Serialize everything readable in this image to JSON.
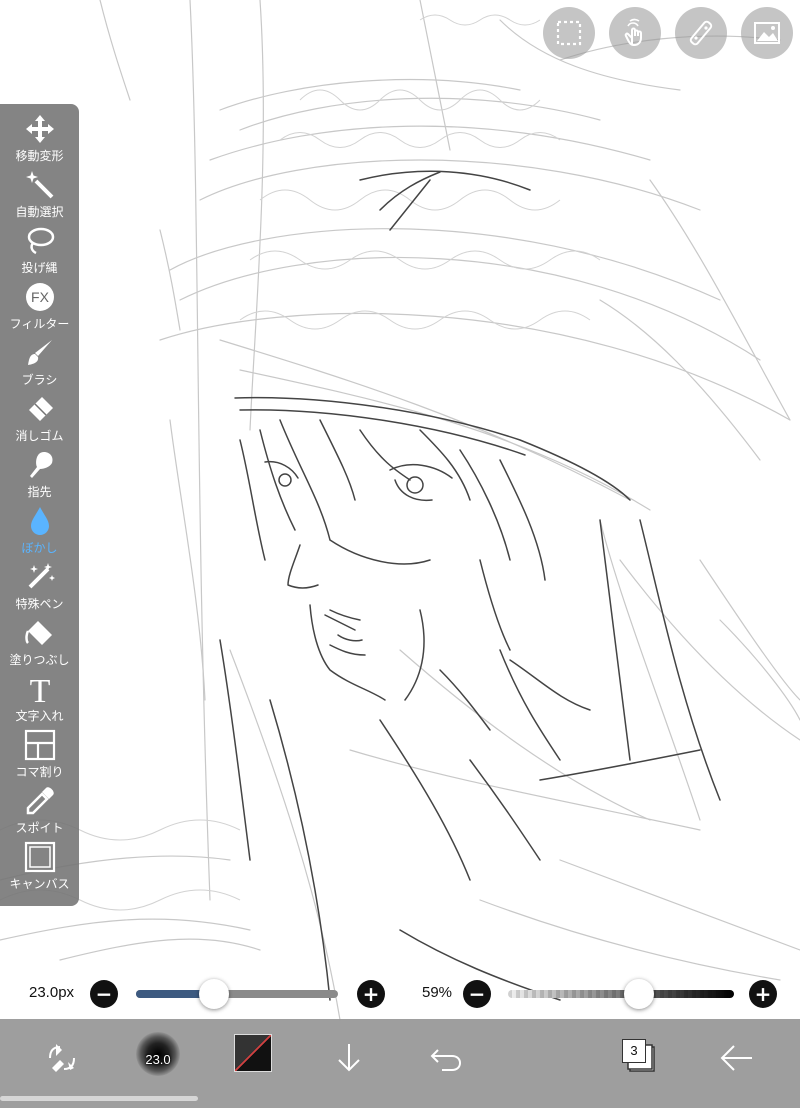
{
  "top_buttons": [
    {
      "name": "selection-icon"
    },
    {
      "name": "touch-gesture-icon"
    },
    {
      "name": "ruler-icon"
    },
    {
      "name": "gallery-icon"
    }
  ],
  "tools": [
    {
      "label": "移動変形",
      "icon": "move-transform-icon",
      "active": false
    },
    {
      "label": "自動選択",
      "icon": "magic-wand-icon",
      "active": false
    },
    {
      "label": "投げ縄",
      "icon": "lasso-icon",
      "active": false
    },
    {
      "label": "フィルター",
      "icon": "filter-fx-icon",
      "icon_text": "FX",
      "active": false
    },
    {
      "label": "ブラシ",
      "icon": "brush-icon",
      "active": false
    },
    {
      "label": "消しゴム",
      "icon": "eraser-icon",
      "active": false
    },
    {
      "label": "指先",
      "icon": "smudge-finger-icon",
      "active": false
    },
    {
      "label": "ぼかし",
      "icon": "blur-drop-icon",
      "active": true
    },
    {
      "label": "特殊ペン",
      "icon": "special-pen-icon",
      "active": false
    },
    {
      "label": "塗りつぶし",
      "icon": "bucket-fill-icon",
      "active": false
    },
    {
      "label": "文字入れ",
      "icon": "text-icon",
      "icon_text": "T",
      "active": false
    },
    {
      "label": "コマ割り",
      "icon": "frame-divider-icon",
      "active": false
    },
    {
      "label": "スポイト",
      "icon": "eyedropper-icon",
      "active": false
    },
    {
      "label": "キャンバス",
      "icon": "canvas-icon",
      "active": false
    }
  ],
  "brush_size": {
    "text": "23.0px",
    "value": 23.0,
    "slider_fraction": 0.38,
    "minus": "−",
    "plus": "+"
  },
  "opacity": {
    "text": "59%",
    "value": 59,
    "slider_fraction": 0.59,
    "minus": "−",
    "plus": "+"
  },
  "bottom_bar": {
    "brush_preview_label": "23.0",
    "layer_count": "3",
    "colors": {
      "primary": "#333333",
      "secondary": "#111111",
      "accent": "#4a6fa5",
      "active_tool": "#5ab4ff"
    }
  }
}
